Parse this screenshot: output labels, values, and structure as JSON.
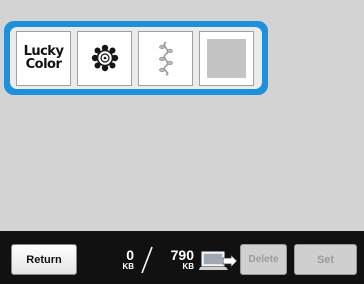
{
  "patterns": {
    "tile1_label_line1": "Lucky",
    "tile1_label_line2": "Color"
  },
  "bottom_bar": {
    "return_label": "Return",
    "used_value": "0",
    "used_unit": "KB",
    "total_value": "790",
    "total_unit": "KB",
    "delete_label": "Delete",
    "set_label": "Set"
  },
  "colors": {
    "selection_border": "#1e8fdb",
    "background": "#d3d3d3",
    "bottom_bar": "#111111"
  }
}
